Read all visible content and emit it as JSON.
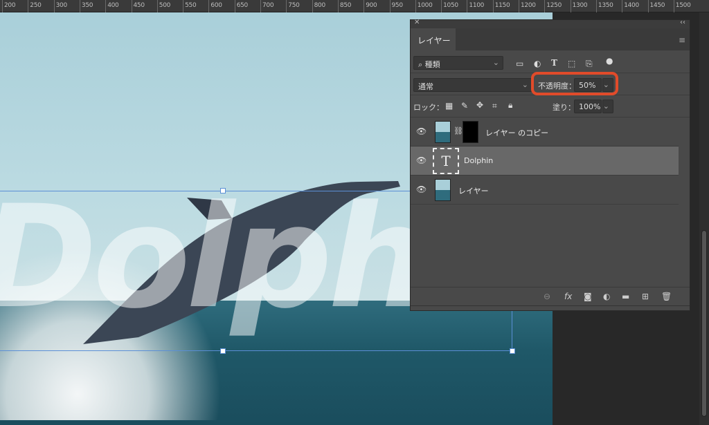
{
  "ruler": {
    "labels": [
      "200",
      "250",
      "300",
      "350",
      "400",
      "450",
      "500",
      "550",
      "600",
      "650",
      "700",
      "750",
      "800",
      "850",
      "900",
      "950",
      "1000",
      "1050",
      "1100",
      "1150",
      "1200",
      "1250",
      "1300",
      "1350",
      "1400",
      "1450",
      "1500"
    ]
  },
  "canvas": {
    "text_layer_content": "Dolphin"
  },
  "panel": {
    "close_label": "✕",
    "collapse_label": "‹‹",
    "tab_label": "レイヤー",
    "menu_icon": "menu-icon",
    "filter": {
      "value": "種類",
      "icons": [
        "image-filter-icon",
        "adjustment-filter-icon",
        "type-filter-icon",
        "shape-filter-icon",
        "smart-object-filter-icon",
        "filter-toggle-icon"
      ]
    },
    "blend_mode": "通常",
    "opacity_label": "不透明度：",
    "opacity_value": "50%",
    "lock_label": "ロック：",
    "lock_icons": [
      "lock-transparent-icon",
      "lock-pixels-icon",
      "lock-position-icon",
      "lock-artboard-icon",
      "lock-all-icon"
    ],
    "fill_label": "塗り：",
    "fill_value": "100%",
    "layers": [
      {
        "name": "レイヤー のコピー",
        "type": "image-with-mask",
        "visible": true,
        "selected": false
      },
      {
        "name": "Dolphin",
        "type": "text",
        "visible": true,
        "selected": true
      },
      {
        "name": "レイヤー",
        "type": "image",
        "visible": true,
        "selected": false
      }
    ],
    "footer_icons": [
      "link-icon",
      "fx-icon",
      "mask-icon",
      "adjustment-icon",
      "folder-icon",
      "new-layer-icon",
      "trash-icon"
    ],
    "fx_label": "fx"
  },
  "colors": {
    "highlight": "#e14b2a",
    "panel_bg": "#494949",
    "selected_layer": "#686868"
  }
}
